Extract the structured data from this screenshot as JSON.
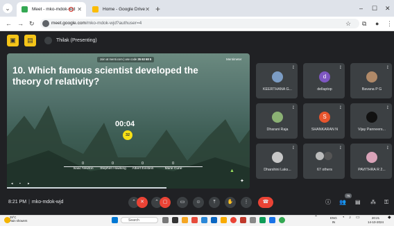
{
  "browser": {
    "tabs": [
      {
        "label": "Meet - mko-mdok-wjd",
        "active": true
      },
      {
        "label": "Home - Google Drive",
        "active": false
      }
    ],
    "url_host": "meet.google.com",
    "url_path": "/mko-mdok-wjd?authuser=4"
  },
  "meet": {
    "presenter_label": "Thilak (Presenting)",
    "join_text": "Join at menti.com | use code",
    "join_code": "35 63 68 5",
    "brand": "Mentimeter",
    "question": "10. Which famous scientist developed the theory of relativity?",
    "timer": "00:04",
    "responses": "32",
    "options": [
      {
        "value": "0",
        "label": "Isaac Newton"
      },
      {
        "value": "0",
        "label": "Stephen Hawking"
      },
      {
        "value": "0",
        "label": "Albert Einstein"
      },
      {
        "value": "0",
        "label": "Marie Curie"
      }
    ],
    "participants": [
      {
        "name": "KEERTHANA G...",
        "initial": "",
        "color": "#7b9cc4"
      },
      {
        "name": "dellaptop",
        "initial": "d",
        "color": "#7e57c2"
      },
      {
        "name": "Bavana P G",
        "initial": "",
        "color": "#b08968"
      },
      {
        "name": "Dharani Raja",
        "initial": "",
        "color": "#8bb174"
      },
      {
        "name": "SHANKARAN N",
        "initial": "S",
        "color": "#e8552d"
      },
      {
        "name": "Vijay Panneers...",
        "initial": "",
        "color": "#111111"
      },
      {
        "name": "Dharshini Laks...",
        "initial": "",
        "color": "#c7c7c7"
      },
      {
        "name": "67 others",
        "initial": "",
        "color": "#9aa0a6"
      },
      {
        "name": "PAVITHRA R 2...",
        "initial": "",
        "color": "#d9a3b8"
      }
    ],
    "time": "8:21 PM",
    "meeting_code": "mko-mdok-wjd",
    "people_count": "76"
  },
  "taskbar": {
    "temp": "29°C",
    "weather": "Rain showers",
    "search": "Search",
    "lang": "ENG",
    "region": "IN",
    "clock": "20:21",
    "date": "14-10-2024"
  }
}
